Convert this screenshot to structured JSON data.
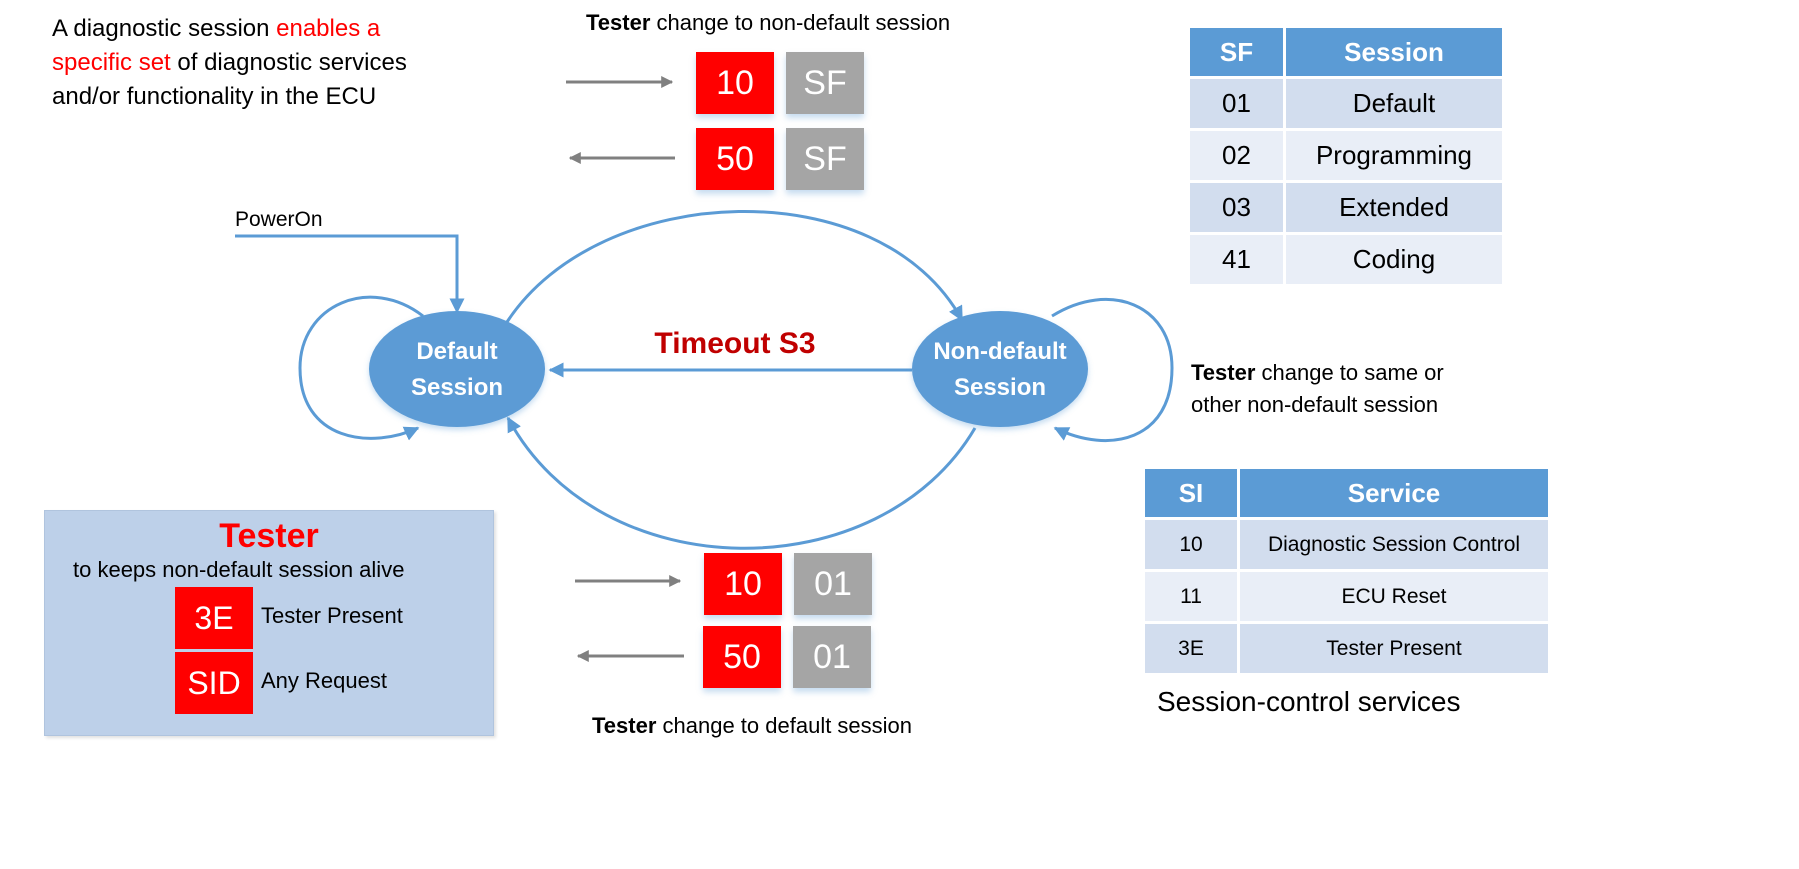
{
  "intro": {
    "part1": "A diagnostic session ",
    "highlight": "enables a specific set",
    "part2": " of diagnostic services and/or functionality in the ECU"
  },
  "top_caption": {
    "bold": "Tester",
    "rest": " change to non-default session"
  },
  "top_request": {
    "sid": "10",
    "param": "SF"
  },
  "top_response": {
    "sid": "50",
    "param": "SF"
  },
  "bottom_caption": {
    "bold": "Tester",
    "rest": " change to default session"
  },
  "bottom_request": {
    "sid": "10",
    "param": "01"
  },
  "bottom_response": {
    "sid": "50",
    "param": "01"
  },
  "nodes": {
    "default": {
      "line1": "Default",
      "line2": "Session"
    },
    "non_default": {
      "line1": "Non-default",
      "line2": "Session"
    }
  },
  "power_on_label": "PowerOn",
  "timeout_label": "Timeout S3",
  "self_loop_caption": {
    "bold": "Tester",
    "line1_rest": " change to same or",
    "line2": "other non-default session"
  },
  "sf_table": {
    "headers": [
      "SF",
      "Session"
    ],
    "rows": [
      [
        "01",
        "Default"
      ],
      [
        "02",
        "Programming"
      ],
      [
        "03",
        "Extended"
      ],
      [
        "41",
        "Coding"
      ]
    ]
  },
  "si_table": {
    "headers": [
      "SI",
      "Service"
    ],
    "rows": [
      [
        "10",
        "Diagnostic Session Control"
      ],
      [
        "11",
        "ECU Reset"
      ],
      [
        "3E",
        "Tester Present"
      ]
    ],
    "caption": "Session-control services"
  },
  "tester_box": {
    "title": "Tester",
    "subtitle": "to keeps non-default session alive",
    "items": [
      {
        "code": "3E",
        "label": "Tester Present"
      },
      {
        "code": "SID",
        "label": "Any Request"
      }
    ]
  },
  "colors": {
    "node_fill": "#5b9bd5",
    "edge": "#5b9bd5",
    "sid_red": "#ff0000",
    "param_gray": "#a5a5a5",
    "timeout_red": "#c00000",
    "arrow_gray": "#808080"
  }
}
